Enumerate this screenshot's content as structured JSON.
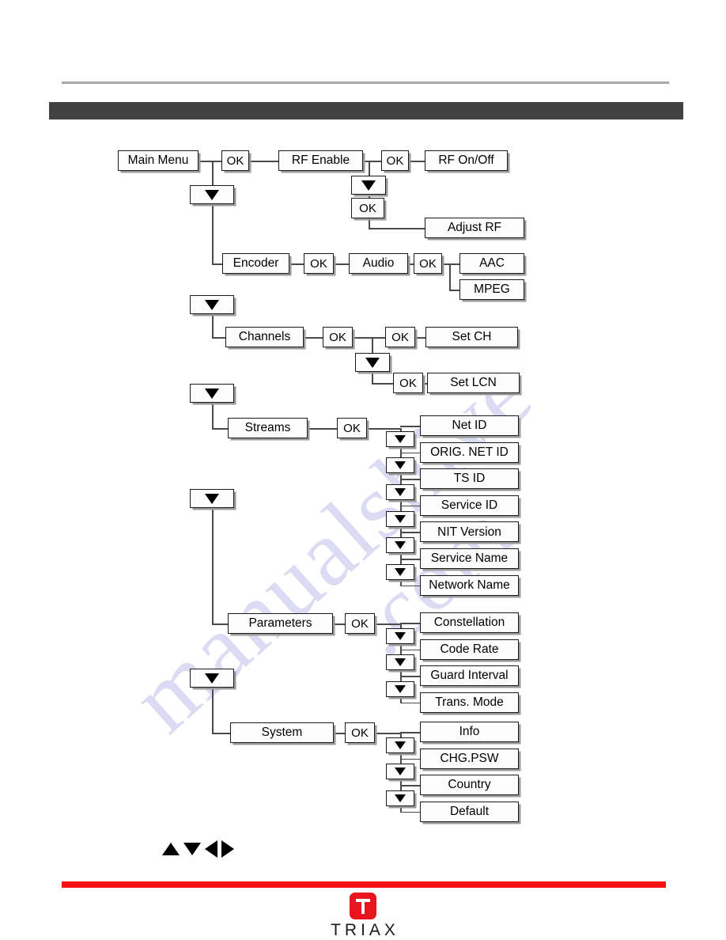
{
  "page": {
    "header_bar_color": "#414141",
    "rule_color": "#a8a8a8",
    "footer_bar_color": "#f41212"
  },
  "watermark": {
    "line1": "manualshive",
    "line2": ".com"
  },
  "logo": {
    "wordmark": "TRIAX",
    "mark_letter": "T",
    "mark_color": "#e8141e"
  },
  "key_legend": {
    "up": "up-arrow",
    "down": "down-arrow",
    "left": "left-arrow",
    "right": "right-arrow"
  },
  "labels": {
    "ok": "OK",
    "down_arrow": "▼"
  },
  "tree": {
    "root": "Main Menu",
    "branches": [
      {
        "name": "RF Enable",
        "items": [
          "RF On/Off",
          "Adjust RF"
        ]
      },
      {
        "name": "Encoder",
        "sub": "Audio",
        "items": [
          "AAC",
          "MPEG"
        ]
      },
      {
        "name": "Channels",
        "items": [
          "Set CH",
          "Set LCN"
        ]
      },
      {
        "name": "Streams",
        "items": [
          "Net ID",
          "ORIG. NET ID",
          "TS ID",
          "Service ID",
          "NIT Version",
          "Service Name",
          "Network Name"
        ]
      },
      {
        "name": "Parameters",
        "items": [
          "Constellation",
          "Code Rate",
          "Guard Interval",
          "Trans. Mode"
        ]
      },
      {
        "name": "System",
        "items": [
          "Info",
          "CHG.PSW",
          "Country",
          "Default"
        ]
      }
    ]
  },
  "nodes": {
    "main_menu": "Main Menu",
    "rf_enable": "RF Enable",
    "rf_on_off": "RF On/Off",
    "adjust_rf": "Adjust RF",
    "encoder": "Encoder",
    "audio": "Audio",
    "aac": "AAC",
    "mpeg": "MPEG",
    "channels": "Channels",
    "set_ch": "Set CH",
    "set_lcn": "Set LCN",
    "streams": "Streams",
    "net_id": "Net ID",
    "orig_net_id": "ORIG. NET ID",
    "ts_id": "TS ID",
    "service_id": "Service ID",
    "nit_version": "NIT Version",
    "service_name": "Service Name",
    "network_name": "Network Name",
    "parameters": "Parameters",
    "constellation": "Constellation",
    "code_rate": "Code Rate",
    "guard_interval": "Guard Interval",
    "trans_mode": "Trans. Mode",
    "system": "System",
    "info": "Info",
    "chg_psw": "CHG.PSW",
    "country": "Country",
    "default": "Default"
  }
}
